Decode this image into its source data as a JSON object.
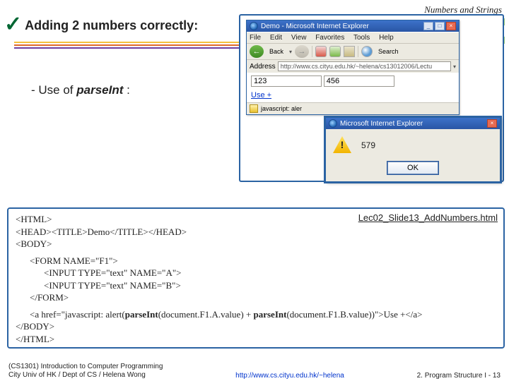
{
  "topic": "Numbers and Strings",
  "heading": "Adding 2 numbers correctly:",
  "subpoint_prefix": "- Use of ",
  "subpoint_fn": "parseInt",
  "subpoint_suffix": " :",
  "browser": {
    "title": "Demo - Microsoft Internet Explorer",
    "menu": [
      "File",
      "Edit",
      "View",
      "Favorites",
      "Tools",
      "Help"
    ],
    "back": "Back",
    "search": "Search",
    "address_label": "Address",
    "address_value": "http://www.cs.cityu.edu.hk/~helena/cs13012006/Lectu",
    "input_a": "123",
    "input_b": "456",
    "use_link": "Use +",
    "status": "javascript: aler"
  },
  "dialog": {
    "title": "Microsoft Internet Explorer",
    "value": "579",
    "ok": "OK"
  },
  "file_label": "Lec02_Slide13_AddNumbers.html",
  "code": {
    "l1": "<HTML>",
    "l2": "<HEAD><TITLE>Demo</TITLE></HEAD>",
    "l3": "<BODY>",
    "l4": "<FORM NAME=\"F1\">",
    "l5": "<INPUT TYPE=\"text\" NAME=\"A\">",
    "l6": "<INPUT TYPE=\"text\" NAME=\"B\">",
    "l7": "</FORM>",
    "l8a": "<a href=\"javascript: alert(",
    "l8b": "parseInt",
    "l8c": "(document.F1.A.value) + ",
    "l8d": "parseInt",
    "l8e": "(document.F1.B.value))\">Use +</a>",
    "l9": "</BODY>",
    "l10": "</HTML>"
  },
  "footer": {
    "left1": "(CS1301) Introduction to Computer Programming",
    "left2": "City Univ of HK / Dept of CS / Helena Wong",
    "center": "http://www.cs.cityu.edu.hk/~helena",
    "right": "2. Program Structure I - 13"
  },
  "lines": {
    "c1": "#f5c13d",
    "c2": "#e06a2b",
    "c3": "#6f3fa0"
  }
}
